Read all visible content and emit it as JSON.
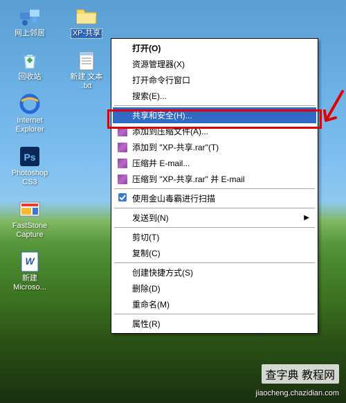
{
  "desktop_icons_col1": [
    {
      "name": "network-neighborhood-icon",
      "label": "网上邻居"
    },
    {
      "name": "recycle-bin-icon",
      "label": "回收站"
    },
    {
      "name": "internet-explorer-icon",
      "label": "Internet\nExplorer"
    },
    {
      "name": "photoshop-icon",
      "label": "Photoshop\nCS3"
    },
    {
      "name": "faststone-icon",
      "label": "FastStone\nCapture"
    },
    {
      "name": "word-icon",
      "label": "新建\nMicroso..."
    }
  ],
  "desktop_icons_col2": [
    {
      "name": "folder-icon",
      "label": "XP-共享",
      "selected": true
    },
    {
      "name": "text-file-icon",
      "label": "新建 文本\n.txt"
    }
  ],
  "context_menu": {
    "groups": [
      [
        {
          "label": "打开(O)",
          "bold": true
        },
        {
          "label": "资源管理器(X)"
        },
        {
          "label": "打开命令行窗口"
        },
        {
          "label": "搜索(E)..."
        }
      ],
      [
        {
          "label": "共享和安全(H)...",
          "highlighted": true
        },
        {
          "label": "添加到压缩文件(A)...",
          "icon": "winrar-icon"
        },
        {
          "label": "添加到 \"XP-共享.rar\"(T)",
          "icon": "winrar-icon"
        },
        {
          "label": "压缩并 E-mail...",
          "icon": "winrar-icon"
        },
        {
          "label": "压缩到 \"XP-共享.rar\" 并 E-mail",
          "icon": "winrar-icon"
        }
      ],
      [
        {
          "label": "使用金山毒霸进行扫描",
          "icon": "scan-icon"
        }
      ],
      [
        {
          "label": "发送到(N)",
          "submenu": true
        }
      ],
      [
        {
          "label": "剪切(T)"
        },
        {
          "label": "复制(C)"
        }
      ],
      [
        {
          "label": "创建快捷方式(S)"
        },
        {
          "label": "删除(D)"
        },
        {
          "label": "重命名(M)"
        }
      ],
      [
        {
          "label": "属性(R)"
        }
      ]
    ]
  },
  "watermark_main": "查字典  教程网",
  "watermark_sub": "jiaocheng.chazidian.com"
}
